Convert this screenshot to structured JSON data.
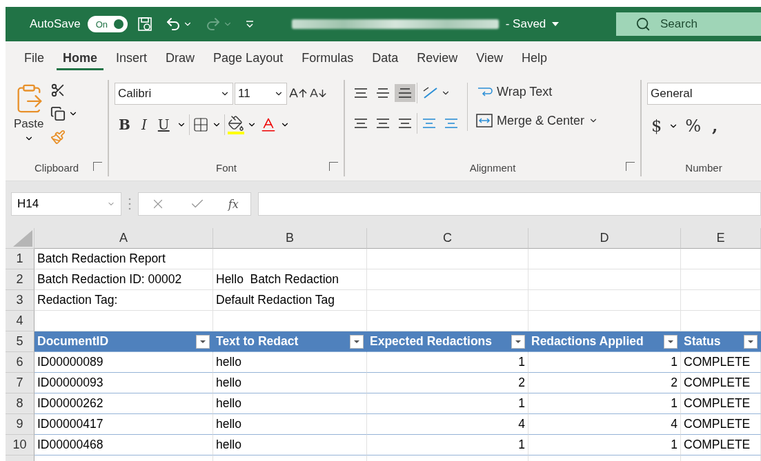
{
  "title_bar": {
    "autosave_label": "AutoSave",
    "autosave_toggle": {
      "label": "On",
      "on": true
    },
    "saved_status": "- Saved",
    "search_placeholder": "Search"
  },
  "ribbon_tabs": [
    {
      "label": "File",
      "selected": false
    },
    {
      "label": "Home",
      "selected": true
    },
    {
      "label": "Insert",
      "selected": false
    },
    {
      "label": "Draw",
      "selected": false
    },
    {
      "label": "Page Layout",
      "selected": false
    },
    {
      "label": "Formulas",
      "selected": false
    },
    {
      "label": "Data",
      "selected": false
    },
    {
      "label": "Review",
      "selected": false
    },
    {
      "label": "View",
      "selected": false
    },
    {
      "label": "Help",
      "selected": false
    }
  ],
  "ribbon": {
    "clipboard": {
      "paste_label": "Paste",
      "group_label": "Clipboard"
    },
    "font": {
      "name": "Calibri",
      "size": "11",
      "format_buttons": [
        "B",
        "I",
        "U"
      ],
      "group_label": "Font"
    },
    "alignment": {
      "bottom_align_selected": true,
      "wrap_text": "Wrap Text",
      "merge_center": "Merge & Center",
      "group_label": "Alignment"
    },
    "number": {
      "format": "General",
      "number_buttons": [
        "$",
        "%",
        ","
      ],
      "group_label": "Number"
    }
  },
  "formula_bar": {
    "name_box": "H14",
    "function_label": "fx"
  },
  "sheet": {
    "columns": [
      {
        "letter": "A",
        "numeric": false
      },
      {
        "letter": "B",
        "numeric": false
      },
      {
        "letter": "C",
        "numeric": true
      },
      {
        "letter": "D",
        "numeric": true
      },
      {
        "letter": "E",
        "numeric": false
      }
    ],
    "rows": [
      {
        "number": "1",
        "kind": "plain",
        "cells": [
          "Batch Redaction Report"
        ]
      },
      {
        "number": "2",
        "kind": "plain",
        "cells": [
          "Batch Redaction ID: 00002",
          "Hello  Batch Redaction"
        ]
      },
      {
        "number": "3",
        "kind": "plain",
        "cells": [
          "Redaction Tag:",
          "Default Redaction Tag"
        ]
      },
      {
        "number": "4",
        "kind": "plain"
      },
      {
        "number": "5",
        "kind": "table_header",
        "cells": [
          "DocumentID",
          "Text to Redact",
          "Expected Redactions",
          "Redactions Applied",
          "Status"
        ]
      },
      {
        "number": "6",
        "kind": "table_row",
        "cells": [
          "ID00000089",
          "hello",
          "1",
          "1",
          "COMPLETE"
        ]
      },
      {
        "number": "7",
        "kind": "table_row",
        "cells": [
          "ID00000093",
          "hello",
          "2",
          "2",
          "COMPLETE"
        ]
      },
      {
        "number": "8",
        "kind": "table_row",
        "cells": [
          "ID00000262",
          "hello",
          "1",
          "1",
          "COMPLETE"
        ]
      },
      {
        "number": "9",
        "kind": "table_row",
        "cells": [
          "ID00000417",
          "hello",
          "4",
          "4",
          "COMPLETE"
        ]
      },
      {
        "number": "10",
        "kind": "table_row",
        "cells": [
          "ID00000468",
          "hello",
          "1",
          "1",
          "COMPLETE"
        ]
      }
    ]
  }
}
